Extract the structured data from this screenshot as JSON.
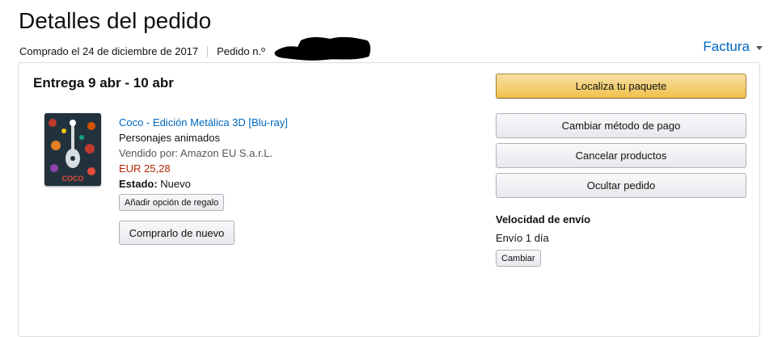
{
  "page": {
    "title": "Detalles del pedido"
  },
  "order_meta": {
    "purchased": "Comprado el 24 de diciembre de 2017",
    "order_number_label": "Pedido n.º"
  },
  "invoice": {
    "label": "Factura"
  },
  "shipment": {
    "delivery": "Entrega 9 abr - 10 abr",
    "product": {
      "title": "Coco - Edición Metálica 3D [Blu-ray]",
      "category": "Personajes animados",
      "seller": "Vendido por: Amazon EU S.a.r.L.",
      "price": "EUR 25,28",
      "state_label": "Estado:",
      "state_value": "Nuevo",
      "gift_button": "Añadir opción de regalo",
      "rebuy_button": "Comprarlo de nuevo",
      "image_icon": "coco-bluray-cover-icon"
    }
  },
  "actions": {
    "track": "Localiza tu paquete",
    "change_payment": "Cambiar método de pago",
    "cancel": "Cancelar productos",
    "hide": "Ocultar pedido"
  },
  "shipping_speed": {
    "title": "Velocidad de envío",
    "value": "Envío 1 día",
    "change_button": "Cambiar"
  },
  "colors": {
    "link": "#0066c0",
    "price": "#b12704",
    "primary_button": "#f0c14b"
  }
}
